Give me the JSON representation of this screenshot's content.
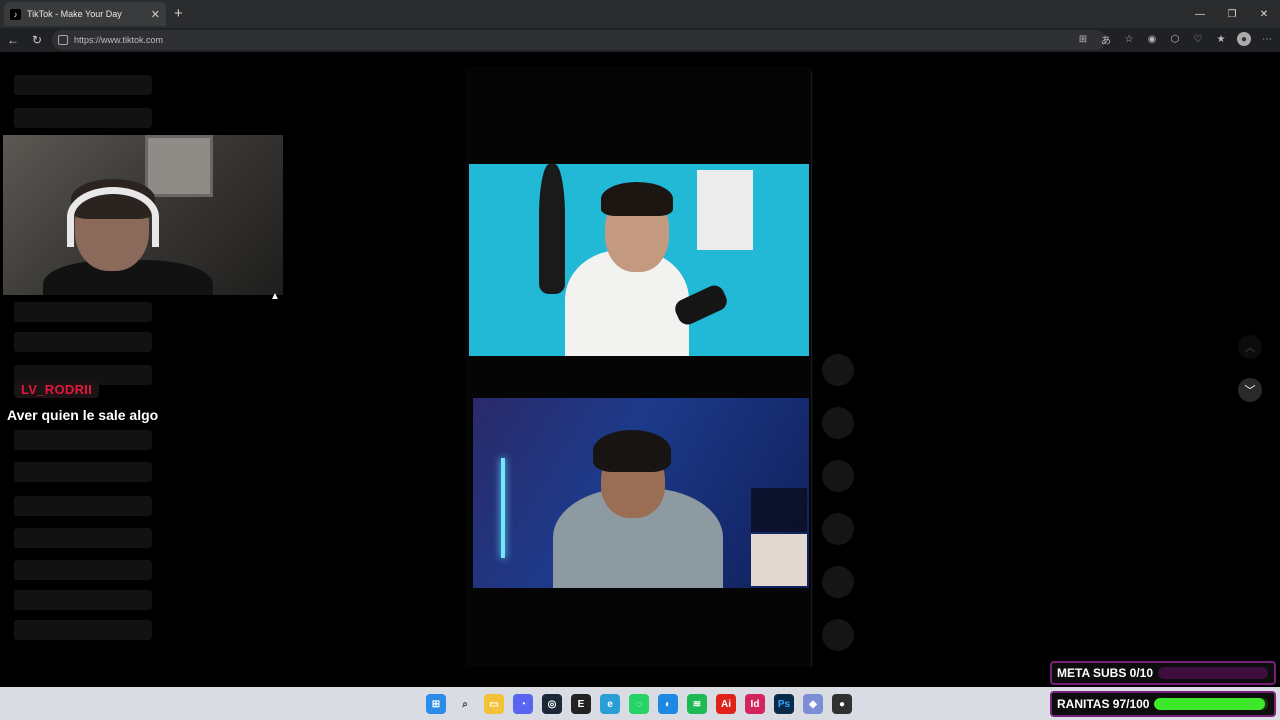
{
  "browser": {
    "tab_title": "TikTok - Make Your Day",
    "tab_close": "✕",
    "new_tab": "+",
    "url": "https://www.tiktok.com",
    "window_controls": [
      "—",
      "❐",
      "✕"
    ],
    "nav": {
      "back": "←",
      "refresh": "↻"
    }
  },
  "stream_overlay": {
    "chat_username": "LV_RODRII",
    "chat_message": "Aver quien le sale algo"
  },
  "goals": {
    "meta_subs_label": "META SUBS 0/10",
    "meta_subs_progress": 0,
    "ranitas_label": "RANITAS 97/100",
    "ranitas_progress": 0.97
  },
  "feed": {
    "scroll_up_icon": "chevron-up-icon",
    "scroll_down_icon": "chevron-down-icon"
  },
  "taskbar": {
    "icons": [
      "windows-start-icon",
      "search-icon",
      "file-explorer-icon",
      "discord-icon",
      "steam-icon",
      "epic-games-icon",
      "edge-icon",
      "whatsapp-icon",
      "app-icon",
      "spotify-icon",
      "illustrator-icon",
      "indesign-icon",
      "photoshop-icon",
      "app-icon-2",
      "obs-icon"
    ]
  },
  "colors": {
    "chat_username": "#e8153a",
    "goal_border": "#7a1f7a",
    "ranitas_fill": "#3ee82a",
    "video1_bg": "#21b9d6"
  }
}
